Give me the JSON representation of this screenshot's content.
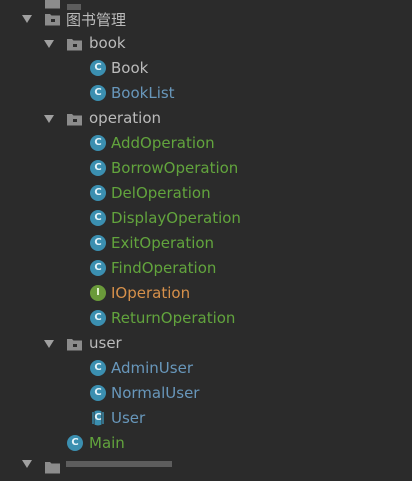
{
  "tree": {
    "root": {
      "label": "图书管理"
    },
    "packages": [
      {
        "label": "book",
        "children": [
          {
            "label": "Book",
            "kind": "class",
            "color": "#bbbbbb"
          },
          {
            "label": "BookList",
            "kind": "class",
            "color": "#6897bb"
          }
        ]
      },
      {
        "label": "operation",
        "children": [
          {
            "label": "AddOperation",
            "kind": "class",
            "color": "#62a43d"
          },
          {
            "label": "BorrowOperation",
            "kind": "class",
            "color": "#62a43d"
          },
          {
            "label": "DelOperation",
            "kind": "class",
            "color": "#62a43d"
          },
          {
            "label": "DisplayOperation",
            "kind": "class",
            "color": "#62a43d"
          },
          {
            "label": "ExitOperation",
            "kind": "class",
            "color": "#62a43d"
          },
          {
            "label": "FindOperation",
            "kind": "class",
            "color": "#62a43d"
          },
          {
            "label": "IOperation",
            "kind": "interface",
            "color": "#d6904a"
          },
          {
            "label": "ReturnOperation",
            "kind": "class",
            "color": "#62a43d"
          }
        ]
      },
      {
        "label": "user",
        "children": [
          {
            "label": "AdminUser",
            "kind": "class",
            "color": "#6897bb"
          },
          {
            "label": "NormalUser",
            "kind": "class",
            "color": "#6897bb"
          },
          {
            "label": "User",
            "kind": "abstract",
            "color": "#6897bb"
          }
        ]
      }
    ],
    "main": {
      "label": "Main",
      "color": "#62a43d"
    },
    "icon_letters": {
      "class": "C",
      "interface": "I"
    }
  },
  "colors": {
    "background": "#2b2b2b",
    "text_default": "#bbbbbb",
    "modified_blue": "#6897bb",
    "added_green": "#62a43d",
    "interface_orange": "#d6904a",
    "class_icon": "#3b8fb0",
    "interface_icon": "#6a9a3a"
  }
}
